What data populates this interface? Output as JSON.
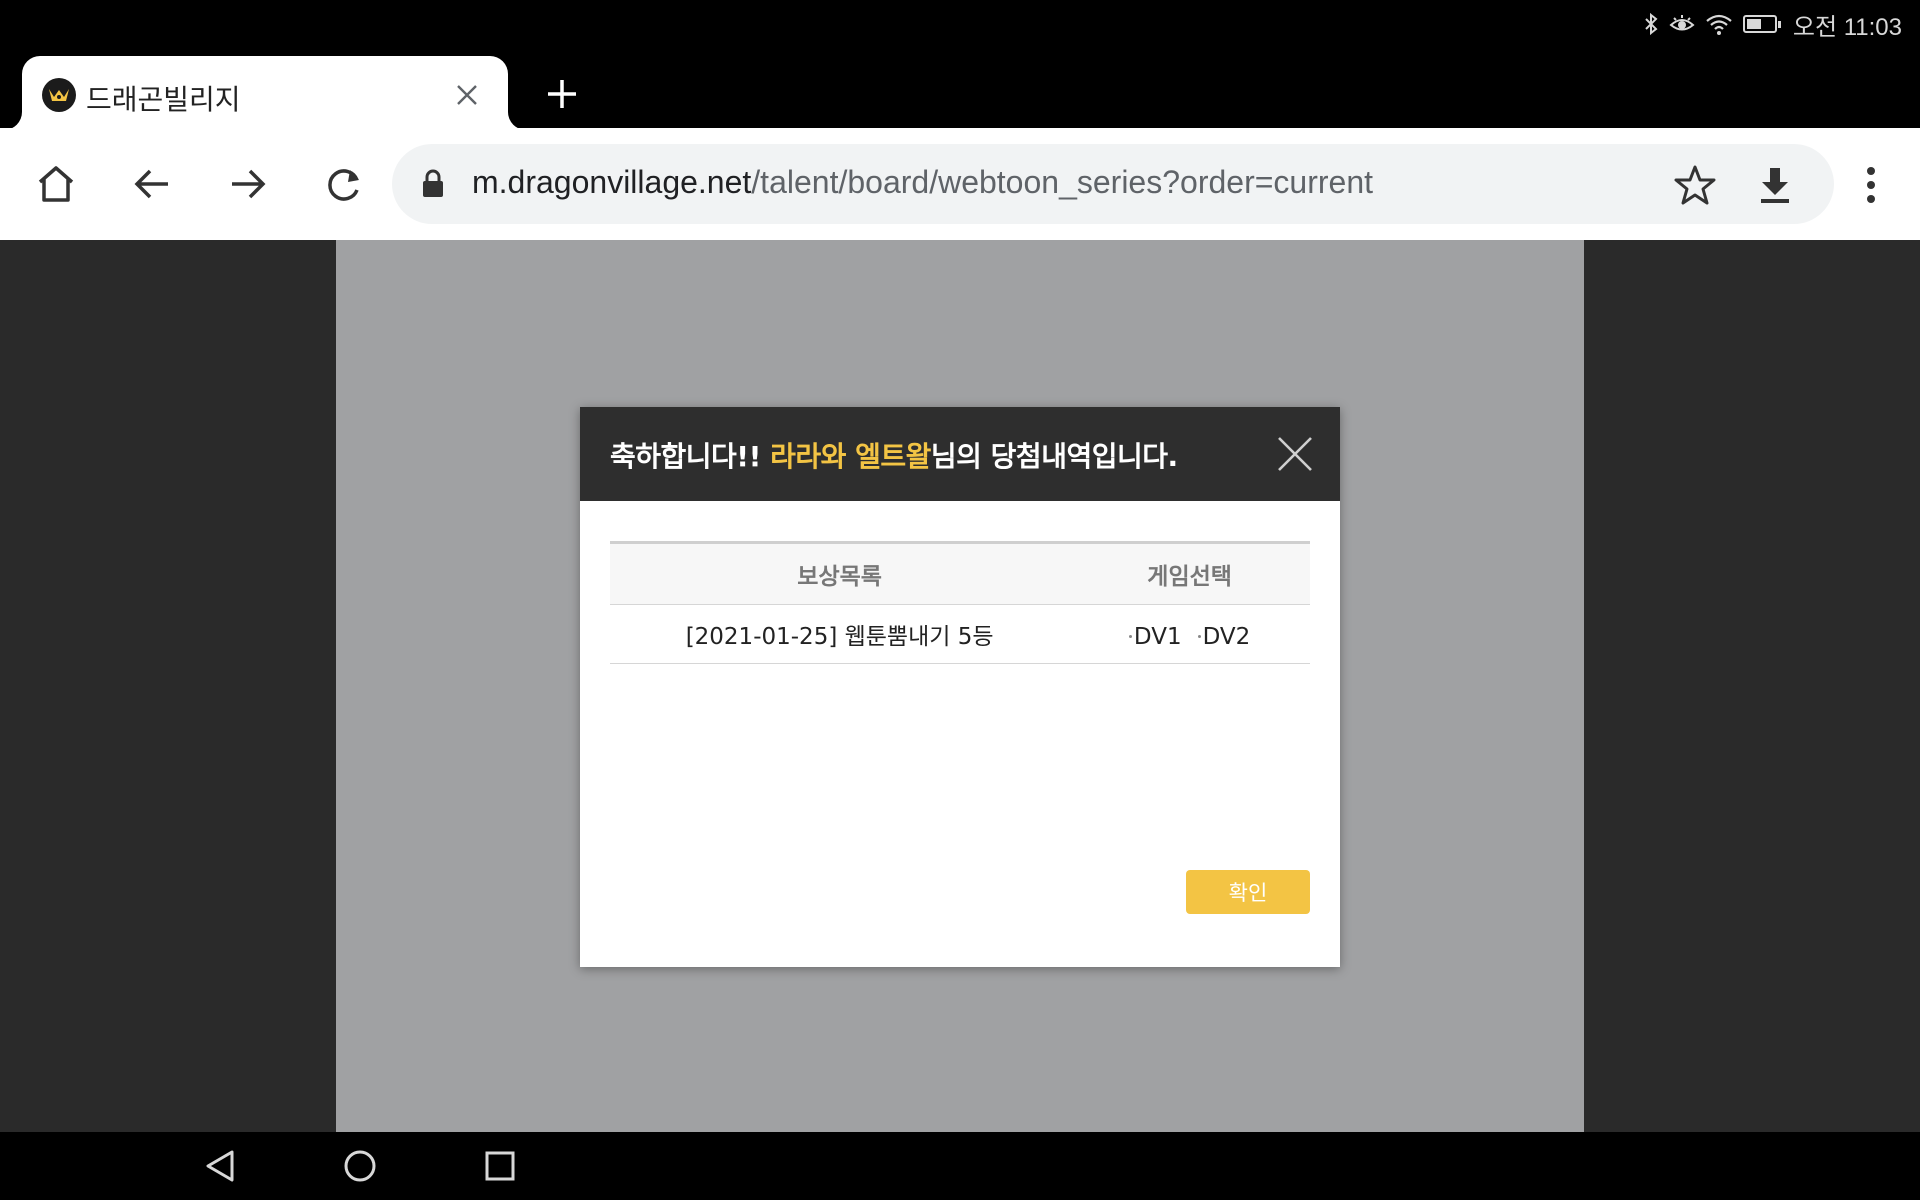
{
  "status_bar": {
    "time": "오전 11:03",
    "icons": [
      "bluetooth-icon",
      "eye-comfort-icon",
      "wifi-icon",
      "battery-icon"
    ]
  },
  "browser": {
    "tab": {
      "title": "드래곤빌리지",
      "favicon": "dragon-village-logo-icon"
    },
    "url": {
      "host": "m.dragonvillage.net",
      "path": "/talent/board/webtoon_series?order=current"
    },
    "toolbar_icons": [
      "home-icon",
      "back-arrow-icon",
      "forward-arrow-icon",
      "reload-icon",
      "lock-icon",
      "star-icon",
      "download-icon",
      "more-vert-icon"
    ]
  },
  "modal": {
    "title_prefix": "축하합니다!! ",
    "username": "라라와 엘트왈",
    "title_suffix": "님의 당첨내역입니다.",
    "table": {
      "headers": [
        "보상목록",
        "게임선택"
      ],
      "rows": [
        {
          "reward": "[2021-01-25] 웹툰뿜내기 5등",
          "games": [
            "DV1",
            "DV2"
          ]
        }
      ]
    },
    "confirm_label": "확인",
    "colors": {
      "header_bg": "#2e2e2e",
      "highlight": "#f3c444",
      "button": "#f3c444"
    }
  },
  "nav_bar": {
    "icons": [
      "nav-back-icon",
      "nav-home-icon",
      "nav-recents-icon"
    ]
  }
}
